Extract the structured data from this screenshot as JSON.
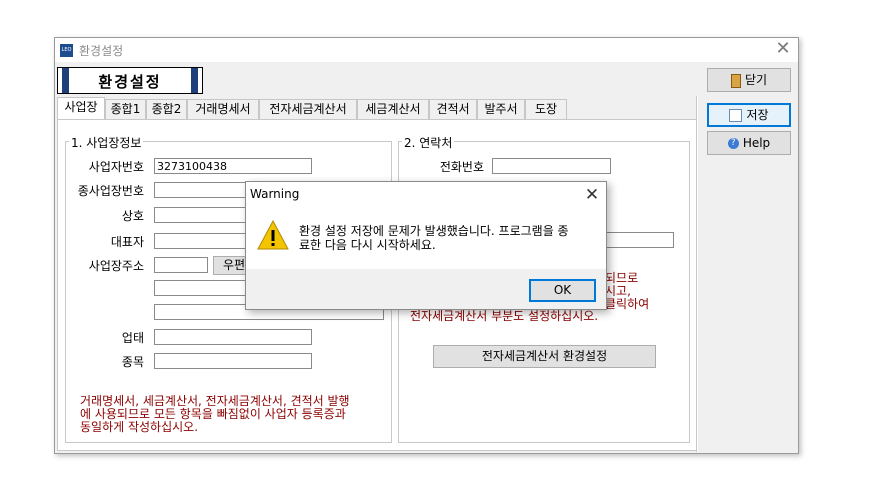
{
  "window": {
    "title": "환경설정",
    "icon_text": "LEO",
    "header_title": "환경설정"
  },
  "buttons": {
    "close": "닫기",
    "save": "저장",
    "help": "Help"
  },
  "tabs": [
    "사업장",
    "종합1",
    "종합2",
    "거래명세서",
    "전자세금계산서",
    "세금계산서",
    "견적서",
    "발주서",
    "도장"
  ],
  "business": {
    "group_title": "1. 사업장정보",
    "labels": {
      "reg_no": "사업자번호",
      "sub_reg_no": "종사업장번호",
      "company": "상호",
      "ceo": "대표자",
      "address": "사업장주소",
      "biz_type": "업태",
      "biz_item": "종목"
    },
    "values": {
      "reg_no": "3273100438"
    },
    "zip_button": "우편",
    "note": [
      "거래명세서, 세금계산서, 전자세금계산서, 견적서 발행",
      "에 사용되므로 모든 항목을 빠짐없이 사업자 등록증과",
      "동일하게 작성하십시오."
    ]
  },
  "contact": {
    "group_title": "2. 연락처",
    "labels": {
      "phone": "전화번호"
    },
    "note_partial": [
      "되므로",
      "시고,",
      "클릭하여"
    ],
    "note_last": "전자세금계산서 부분도 설정하십시오.",
    "einvoice_button": "전자세금계산서 환경설정"
  },
  "dialog": {
    "title": "Warning",
    "message_line1": "환경 설정 저장에 문제가 발생했습니다. 프로그램을 종",
    "message_line2": "료한 다음 다시 시작하세요.",
    "ok": "OK",
    "warning_color": "#f5c400"
  }
}
